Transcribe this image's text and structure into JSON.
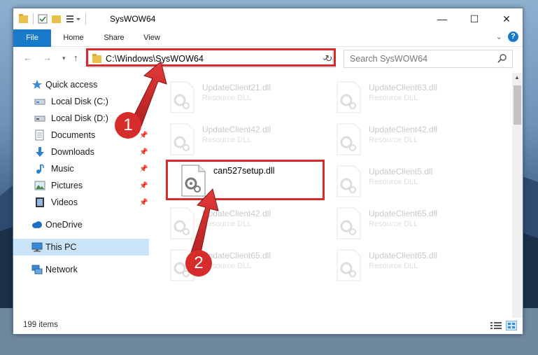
{
  "window": {
    "title": "SysWOW64",
    "minimize_glyph": "—",
    "maximize_glyph": "☐",
    "close_glyph": "✕"
  },
  "ribbon": {
    "tabs": [
      {
        "label": "File"
      },
      {
        "label": "Home"
      },
      {
        "label": "Share"
      },
      {
        "label": "View"
      }
    ],
    "help": "?"
  },
  "address": {
    "path": "C:\\Windows\\SysWOW64",
    "search_placeholder": "Search SysWOW64"
  },
  "sidebar": {
    "items": [
      {
        "label": "Quick access",
        "icon": "star-icon"
      },
      {
        "label": "Local Disk (C:)",
        "icon": "drive-icon"
      },
      {
        "label": "Local Disk (D:)",
        "icon": "drive-icon"
      },
      {
        "label": "Documents",
        "icon": "documents-icon"
      },
      {
        "label": "Downloads",
        "icon": "download-icon"
      },
      {
        "label": "Music",
        "icon": "music-icon"
      },
      {
        "label": "Pictures",
        "icon": "pictures-icon"
      },
      {
        "label": "Videos",
        "icon": "videos-icon"
      },
      {
        "label": "OneDrive",
        "icon": "cloud-icon"
      },
      {
        "label": "This PC",
        "icon": "computer-icon"
      },
      {
        "label": "Network",
        "icon": "network-icon"
      }
    ]
  },
  "files": [
    {
      "name": "UpdateClient21.dll",
      "type": "Resource DLL"
    },
    {
      "name": "UpdateClient63.dll",
      "type": "Resource DLL"
    },
    {
      "name": "UpdateClient42.dll",
      "type": "Resource DLL"
    },
    {
      "name": "UpdateClient42.dll",
      "type": "Resource DLL"
    },
    {
      "name": "can527setup.dll",
      "type": ""
    },
    {
      "name": "UpdateClient5.dll",
      "type": "Resource DLL"
    },
    {
      "name": "UpdateClient42.dll",
      "type": "Resource DLL"
    },
    {
      "name": "UpdateClient65.dll",
      "type": "Resource DLL"
    },
    {
      "name": "UpdateClient65.dll",
      "type": "Resource DLL"
    },
    {
      "name": "UpdateClient65.dll",
      "type": "Resource DLL"
    }
  ],
  "status": {
    "item_count": "199 items"
  },
  "callouts": {
    "one": "1",
    "two": "2"
  },
  "colors": {
    "accent": "#1979ca",
    "highlight": "#d62c2c",
    "selected": "#cce4f7"
  }
}
